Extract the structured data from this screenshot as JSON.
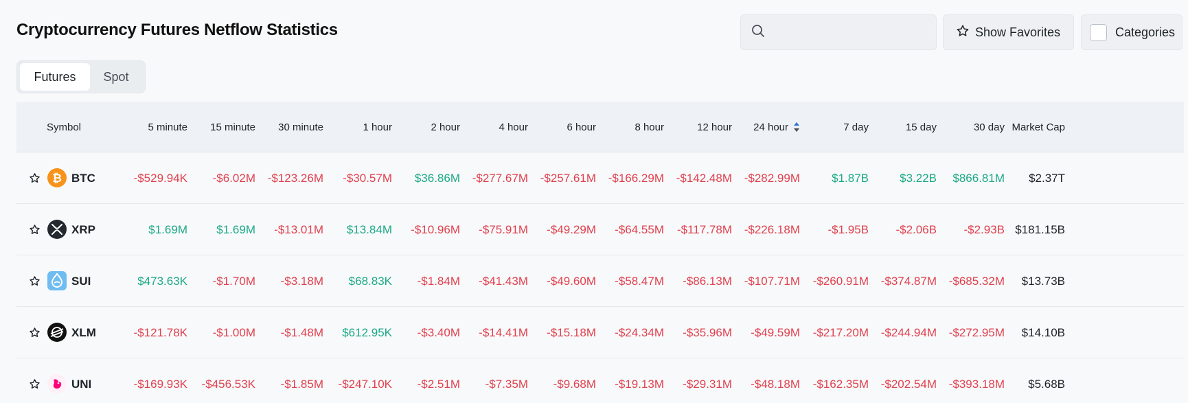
{
  "title": "Cryptocurrency Futures Netflow Statistics",
  "search": {
    "placeholder": "",
    "value": ""
  },
  "show_favorites_label": "Show Favorites",
  "categories_label": "Categories",
  "tabs": [
    {
      "label": "Futures",
      "active": true
    },
    {
      "label": "Spot",
      "active": false
    }
  ],
  "table": {
    "symbol_header": "Symbol",
    "columns": [
      "5 minute",
      "15 minute",
      "30 minute",
      "1 hour",
      "2 hour",
      "4 hour",
      "6 hour",
      "8 hour",
      "12 hour",
      "24 hour",
      "7 day",
      "15 day",
      "30 day",
      "Market Cap"
    ],
    "sorted_column": "24 hour",
    "colors": {
      "negative": "#e0414f",
      "positive": "#1ca988",
      "neutral": "#1e2329"
    },
    "rows": [
      {
        "symbol": "BTC",
        "icon": "bitcoin-icon",
        "values": [
          "-$529.94K",
          "-$6.02M",
          "-$123.26M",
          "-$30.57M",
          "$36.86M",
          "-$277.67M",
          "-$257.61M",
          "-$166.29M",
          "-$142.48M",
          "-$282.99M",
          "$1.87B",
          "$3.22B",
          "$866.81M",
          "$2.37T"
        ]
      },
      {
        "symbol": "XRP",
        "icon": "xrp-icon",
        "values": [
          "$1.69M",
          "$1.69M",
          "-$13.01M",
          "$13.84M",
          "-$10.96M",
          "-$75.91M",
          "-$49.29M",
          "-$64.55M",
          "-$117.78M",
          "-$226.18M",
          "-$1.95B",
          "-$2.06B",
          "-$2.93B",
          "$181.15B"
        ]
      },
      {
        "symbol": "SUI",
        "icon": "sui-icon",
        "values": [
          "$473.63K",
          "-$1.70M",
          "-$3.18M",
          "$68.83K",
          "-$1.84M",
          "-$41.43M",
          "-$49.60M",
          "-$58.47M",
          "-$86.13M",
          "-$107.71M",
          "-$260.91M",
          "-$374.87M",
          "-$685.32M",
          "$13.73B"
        ]
      },
      {
        "symbol": "XLM",
        "icon": "stellar-icon",
        "values": [
          "-$121.78K",
          "-$1.00M",
          "-$1.48M",
          "$612.95K",
          "-$3.40M",
          "-$14.41M",
          "-$15.18M",
          "-$24.34M",
          "-$35.96M",
          "-$49.59M",
          "-$217.20M",
          "-$244.94M",
          "-$272.95M",
          "$14.10B"
        ]
      },
      {
        "symbol": "UNI",
        "icon": "uniswap-icon",
        "values": [
          "-$169.93K",
          "-$456.53K",
          "-$1.85M",
          "-$247.10K",
          "-$2.51M",
          "-$7.35M",
          "-$9.68M",
          "-$19.13M",
          "-$29.31M",
          "-$48.18M",
          "-$162.35M",
          "-$202.54M",
          "-$393.18M",
          "$5.68B"
        ]
      }
    ]
  }
}
